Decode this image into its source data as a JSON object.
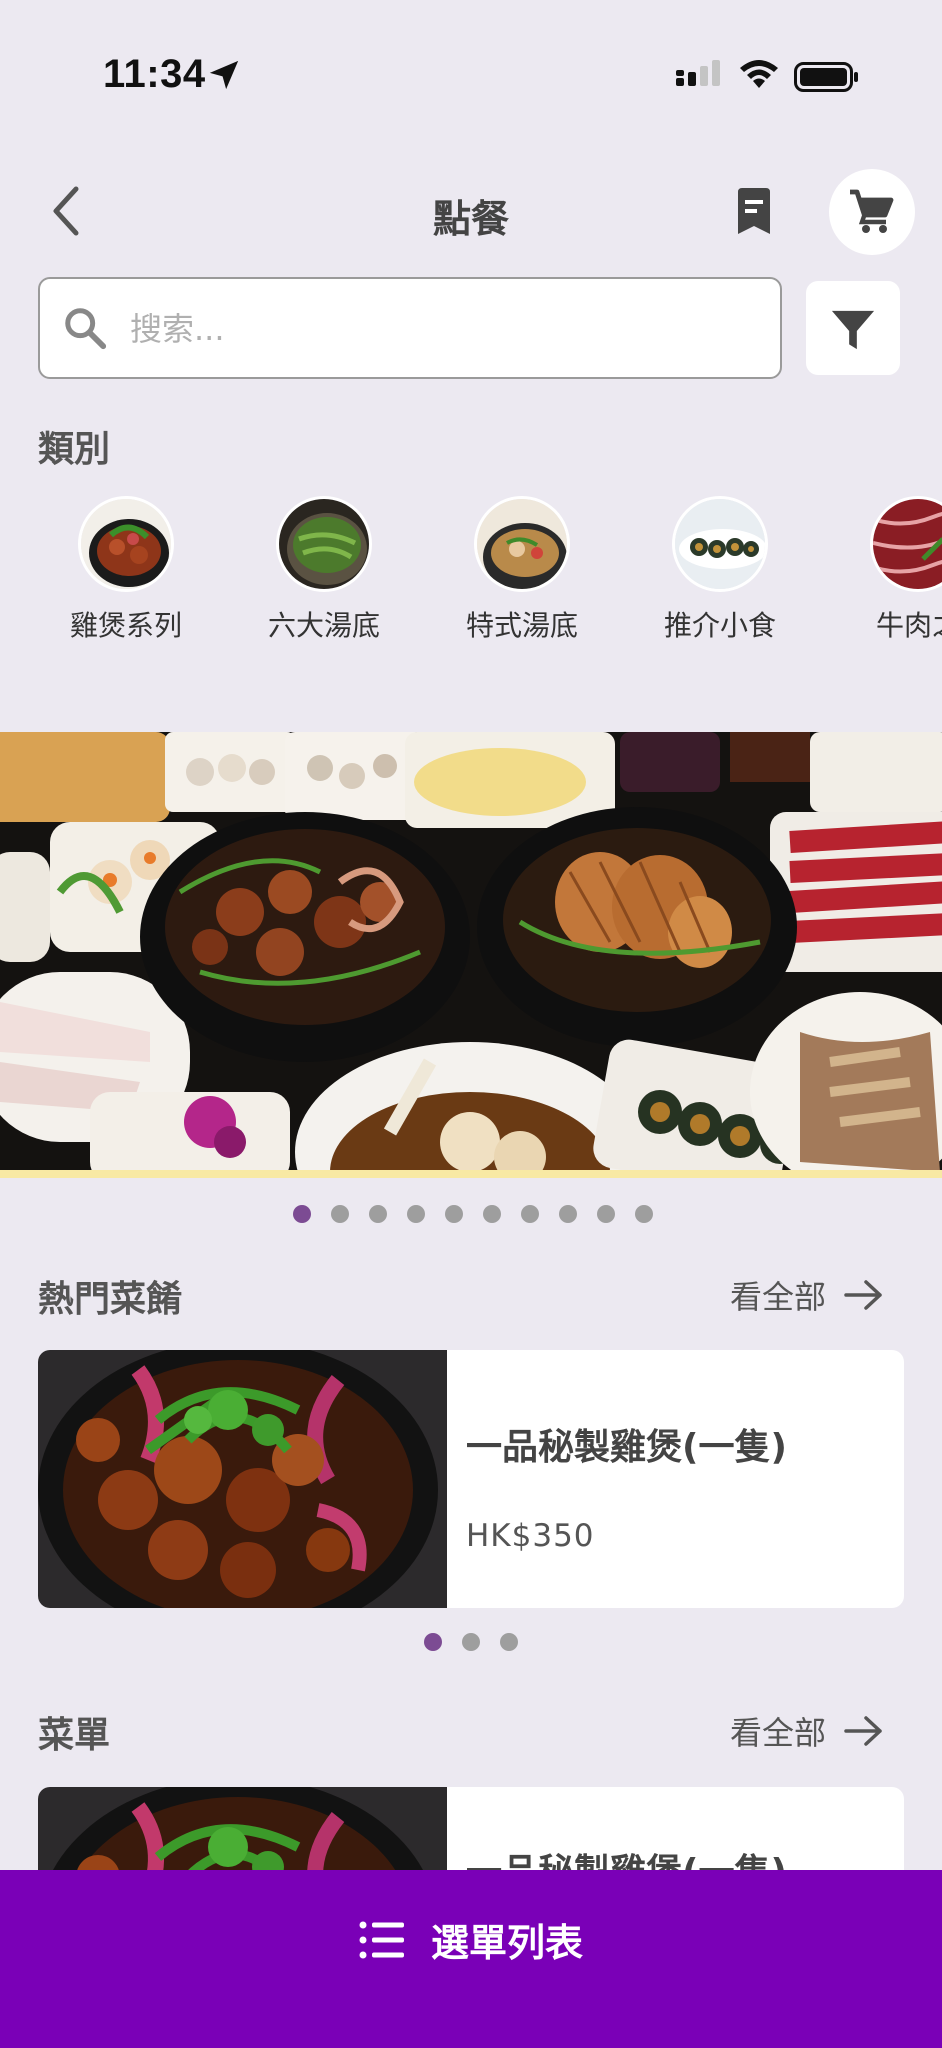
{
  "status": {
    "time": "11:34"
  },
  "header": {
    "title": "點餐"
  },
  "search": {
    "placeholder": "搜索..."
  },
  "categories": {
    "heading": "類別",
    "items": [
      {
        "label": "雞煲系列"
      },
      {
        "label": "六大湯底"
      },
      {
        "label": "特式湯底"
      },
      {
        "label": "推介小食"
      },
      {
        "label": "牛肉之"
      }
    ]
  },
  "banner": {
    "slide_count": 10,
    "active_index": 0
  },
  "popular": {
    "heading": "熱門菜餚",
    "see_all": "看全部",
    "card": {
      "name": "一品秘製雞煲(一隻)",
      "price": "HK$350"
    },
    "page_count": 3,
    "active_index": 0
  },
  "menu": {
    "heading": "菜單",
    "see_all": "看全部",
    "card": {
      "name": "一品秘製雞煲(一隻)"
    }
  },
  "bottom_bar": {
    "label": "選單列表"
  },
  "colors": {
    "accent": "#7A00B7",
    "dot_active": "#7C4B93",
    "background": "#ECE9F1"
  }
}
